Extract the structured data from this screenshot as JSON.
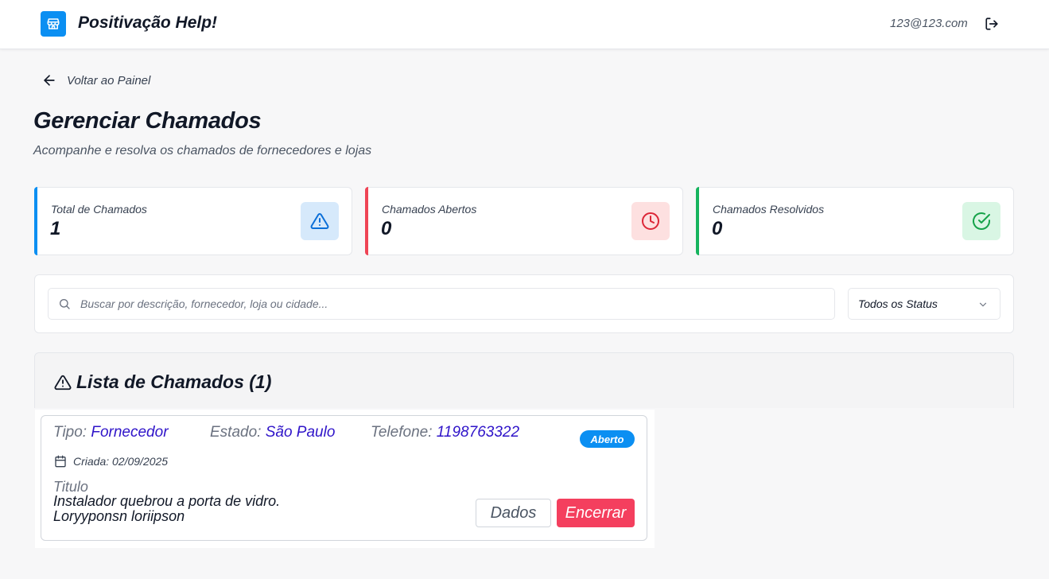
{
  "header": {
    "app_title": "Positivação Help!",
    "user_email": "123@123.com",
    "logo_icon": "store-icon",
    "logout_icon": "logout-icon"
  },
  "nav": {
    "back_label": "Voltar ao Painel"
  },
  "page": {
    "title": "Gerenciar Chamados",
    "subtitle": "Acompanhe e resolva os chamados de fornecedores e lojas"
  },
  "stats": [
    {
      "label": "Total de Chamados",
      "value": "1",
      "icon": "alert-triangle-icon",
      "accent": "#0b8ff2",
      "icon_bg": "#d6e9fb",
      "icon_color": "#0b6fd8"
    },
    {
      "label": "Chamados Abertos",
      "value": "0",
      "icon": "clock-icon",
      "accent": "#ef4455",
      "icon_bg": "#fde0e0",
      "icon_color": "#dc2637"
    },
    {
      "label": "Chamados Resolvidos",
      "value": "0",
      "icon": "check-circle-icon",
      "accent": "#16b45e",
      "icon_bg": "#d9f6e4",
      "icon_color": "#16a34a"
    }
  ],
  "filters": {
    "search_placeholder": "Buscar por descrição, fornecedor, loja ou cidade...",
    "search_value": "",
    "status_selected": "Todos os Status"
  },
  "list": {
    "title": "Lista de Chamados (1)",
    "tickets": [
      {
        "tipo_label": "Tipo:",
        "tipo_value": "Fornecedor",
        "estado_label": "Estado:",
        "estado_value": "São Paulo",
        "telefone_label": "Telefone:",
        "telefone_value": "1198763322",
        "status_badge": "Aberto",
        "created": "Criada: 02/09/2025",
        "titulo_label": "Titulo",
        "description_line1": "Instalador quebrou a porta de vidro.",
        "description_line2": "Loryyponsn loriipson",
        "dados_label": "Dados",
        "encerrar_label": "Encerrar"
      }
    ]
  },
  "colors": {
    "primary": "#0b8ff2",
    "danger": "#f43f5e",
    "link_value": "#2f14c9",
    "background": "#f7f7f8"
  }
}
